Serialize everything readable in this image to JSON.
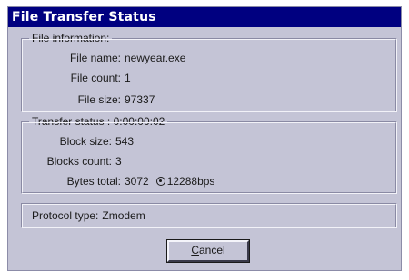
{
  "window": {
    "title": "File Transfer Status"
  },
  "file_info": {
    "group_label": "File information:",
    "name_label": "File name:",
    "name_value": "newyear.exe",
    "count_label": "File count:",
    "count_value": "1",
    "size_label": "File size:",
    "size_value": "97337"
  },
  "transfer_status": {
    "group_label": "Transfer status :",
    "elapsed_time": "0:00:00:02",
    "block_size_label": "Block size:",
    "block_size_value": "543",
    "blocks_count_label": "Blocks count:",
    "blocks_count_value": "3",
    "bytes_total_label": "Bytes total:",
    "bytes_total_value": "3072",
    "speed_icon": "speed-gauge-icon",
    "speed_value": "12288bps"
  },
  "protocol": {
    "label": "Protocol type:",
    "value": "Zmodem"
  },
  "buttons": {
    "cancel_first": "C",
    "cancel_rest": "ancel"
  },
  "colors": {
    "titlebar": "#000080",
    "dialog_bg": "#c4c4d6"
  }
}
